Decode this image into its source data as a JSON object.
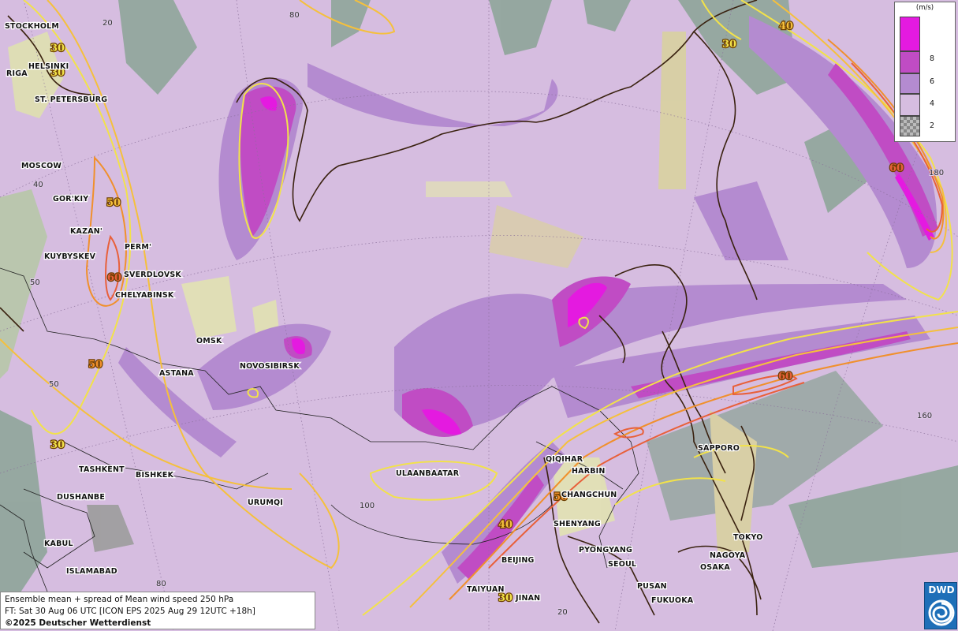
{
  "title_block": {
    "line1": "Ensemble mean + spread of Mean wind speed 250 hPa",
    "line2": "FT: Sat 30 Aug 06 UTC [ICON EPS 2025 Aug 29 12UTC +18h]",
    "copyright": "©2025 Deutscher Wetterdienst"
  },
  "logo": {
    "text": "DWD",
    "icon": "dwd-swirl-icon"
  },
  "legend": {
    "unit": "(m/s)",
    "ticks": [
      "8",
      "6",
      "4",
      "2"
    ],
    "classes": [
      {
        "range": ">10",
        "color": "#e41ae0"
      },
      {
        "range": "8-10",
        "color": "#c04cc4"
      },
      {
        "range": "6-8",
        "color": "#b48bd0"
      },
      {
        "range": "4-6",
        "color": "#d6bde0"
      },
      {
        "range": "<2",
        "color": "checker"
      }
    ]
  },
  "isotach_labels": [
    "30",
    "30",
    "40",
    "30",
    "50",
    "60",
    "50",
    "30",
    "60",
    "50",
    "40",
    "30"
  ],
  "cities": [
    "STOCKHOLM",
    "HELSINKI",
    "RIGA",
    "ST. PETERSBURG",
    "MOSCOW",
    "GOR'KIY",
    "KAZAN'",
    "PERM'",
    "KUYBYSKEV",
    "SVERDLOVSK",
    "CHELYABINSK",
    "OMSK",
    "NOVOSIBIRSK",
    "ASTANA",
    "TASHKENT",
    "BISHKEK",
    "DUSHANBE",
    "URUMQI",
    "KABUL",
    "ISLAMABAD",
    "ULAANBAATAR",
    "QIQIHAR",
    "HARBIN",
    "CHANGCHUN",
    "SHENYANG",
    "PYONGYANG",
    "SEOUL",
    "BEIJING",
    "TAIYUAN",
    "JINAN",
    "PUSAN",
    "FUKUOKA",
    "OSAKA",
    "NAGOYA",
    "TOKYO",
    "SAPPORO"
  ],
  "grid_labels": [
    "20",
    "80",
    "40",
    "50",
    "50",
    "100",
    "80",
    "160",
    "180",
    "20"
  ],
  "colors": {
    "background": "#d6bde0",
    "spread_6": "#b48bd0",
    "spread_8": "#c04cc4",
    "spread_10": "#e41ae0",
    "terrain_green": "#8fa59a",
    "terrain_tan": "#d9d1a0",
    "iso30": "#f2e24a",
    "iso40": "#f5c03c",
    "iso50": "#f0902c",
    "iso60": "#e8603a"
  }
}
